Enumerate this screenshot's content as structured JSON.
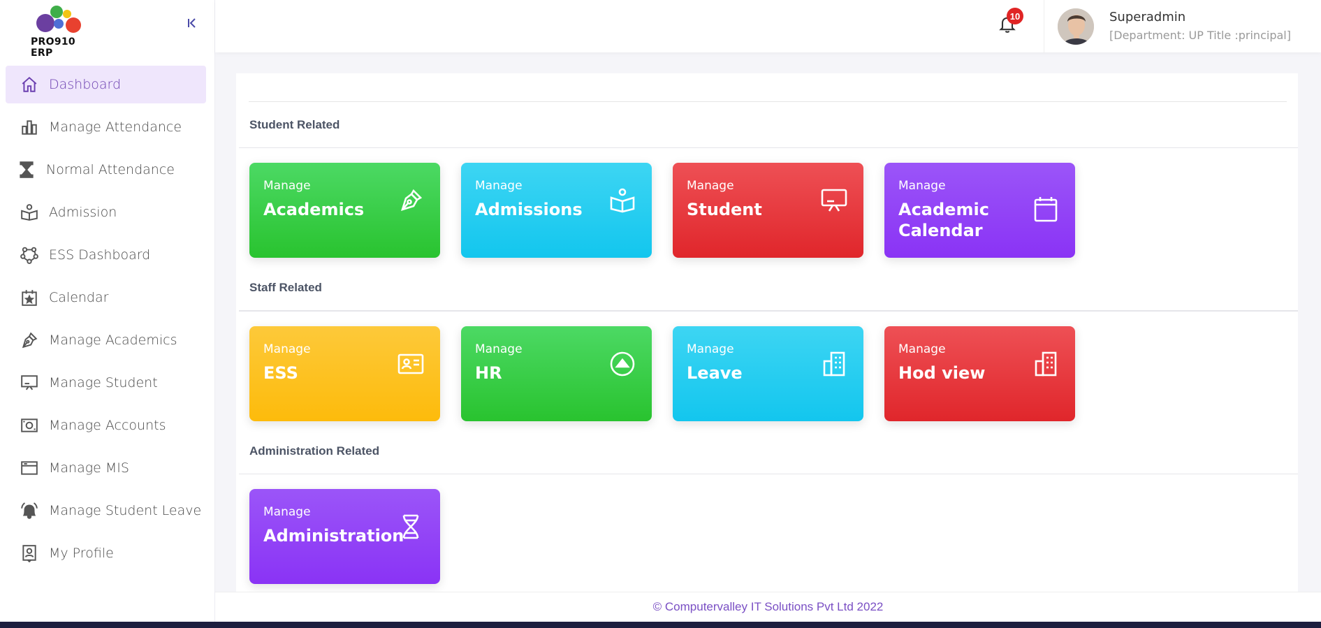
{
  "app": {
    "logo_text": "PRO910 ERP"
  },
  "sidebar": {
    "items": [
      {
        "label": "Dashboard",
        "icon": "home-icon"
      },
      {
        "label": "Manage Attendance",
        "icon": "bar-chart-icon"
      },
      {
        "label": "Normal Attendance",
        "icon": "hourglass-icon"
      },
      {
        "label": "Admission",
        "icon": "book-reader-icon"
      },
      {
        "label": "ESS Dashboard",
        "icon": "network-icon"
      },
      {
        "label": "Calendar",
        "icon": "calendar-star-icon"
      },
      {
        "label": "Manage Academics",
        "icon": "pen-nib-icon"
      },
      {
        "label": "Manage Student",
        "icon": "presentation-icon"
      },
      {
        "label": "Manage Accounts",
        "icon": "money-icon"
      },
      {
        "label": "Manage MIS",
        "icon": "window-icon"
      },
      {
        "label": "Manage Student Leave",
        "icon": "alarm-bell-icon"
      },
      {
        "label": "My Profile",
        "icon": "profile-icon"
      }
    ]
  },
  "header": {
    "notification_count": "10",
    "user_name": "Superadmin",
    "user_sub": "[Department: UP Title :principal]"
  },
  "sections": {
    "student": {
      "title": "Student Related",
      "tiles": [
        {
          "small": "Manage",
          "big": "Academics",
          "icon": "pen-nib-icon"
        },
        {
          "small": "Manage",
          "big": "Admissions",
          "icon": "book-reader-icon"
        },
        {
          "small": "Manage",
          "big": "Student",
          "icon": "presentation-icon"
        },
        {
          "small": "Manage",
          "big": "Academic Calendar",
          "icon": "calendar-icon"
        }
      ]
    },
    "staff": {
      "title": "Staff Related",
      "tiles": [
        {
          "small": "Manage",
          "big": "ESS",
          "icon": "id-card-icon"
        },
        {
          "small": "Manage",
          "big": "HR",
          "icon": "arrow-up-circle-icon"
        },
        {
          "small": "Manage",
          "big": "Leave",
          "icon": "building-icon"
        },
        {
          "small": "Manage",
          "big": "Hod view",
          "icon": "building-icon"
        }
      ]
    },
    "administration": {
      "title": "Administration Related",
      "tiles": [
        {
          "small": "Manage",
          "big": "Administration",
          "icon": "dna-icon"
        }
      ]
    }
  },
  "footer": {
    "text": "© Computervalley IT Solutions Pvt Ltd 2022"
  },
  "colors": {
    "accent": "#6b3fb0",
    "green": "#29c32f",
    "cyan": "#13c6ee",
    "red": "#e0262b",
    "purple": "#8a33f5",
    "yellow": "#fdbb0b"
  }
}
